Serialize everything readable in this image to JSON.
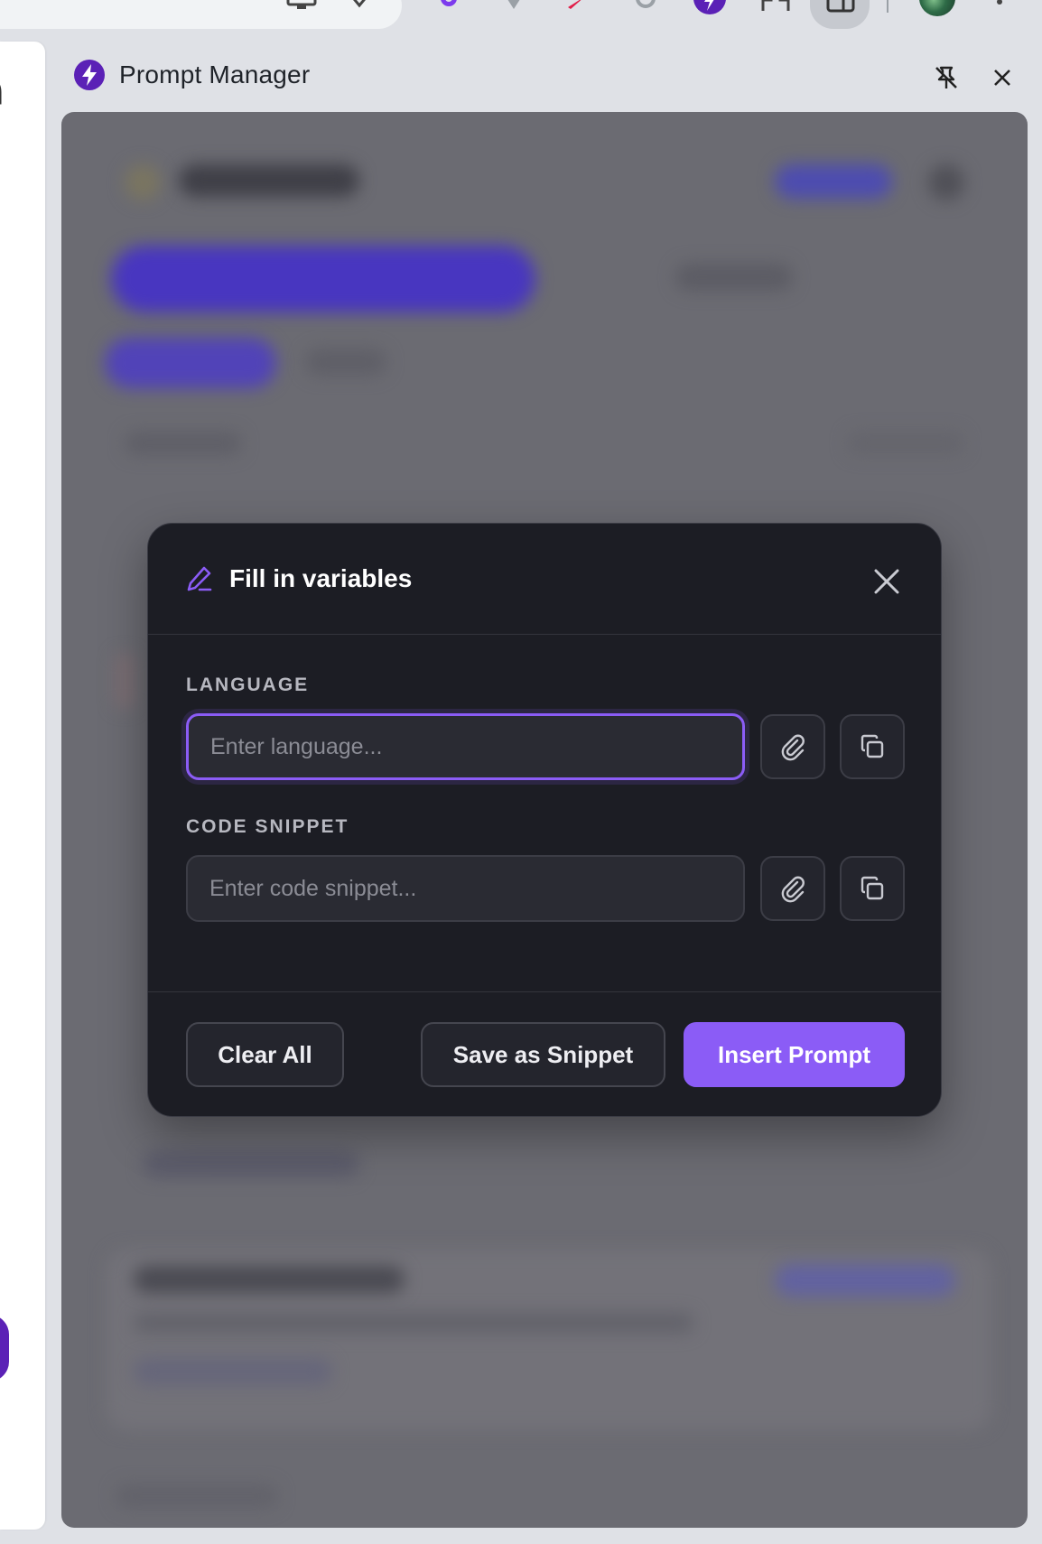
{
  "panel": {
    "title": "Prompt Manager"
  },
  "modal": {
    "title": "Fill in variables",
    "fields": [
      {
        "label": "LANGUAGE",
        "placeholder": "Enter language...",
        "value": ""
      },
      {
        "label": "CODE SNIPPET",
        "placeholder": "Enter code snippet...",
        "value": ""
      }
    ],
    "buttons": {
      "clear": "Clear All",
      "save": "Save as Snippet",
      "insert": "Insert Prompt"
    }
  },
  "colors": {
    "accent": "#8b5cf6",
    "brand": "#5b21b6",
    "modal_bg": "#1c1d24",
    "overlay": "#6b6b72"
  },
  "icons": {
    "panel_logo": "lightning-bolt-icon",
    "unpin": "unpin-icon",
    "close": "close-icon",
    "pen": "pen-icon",
    "attach": "paperclip-icon",
    "copy": "copy-icon"
  }
}
